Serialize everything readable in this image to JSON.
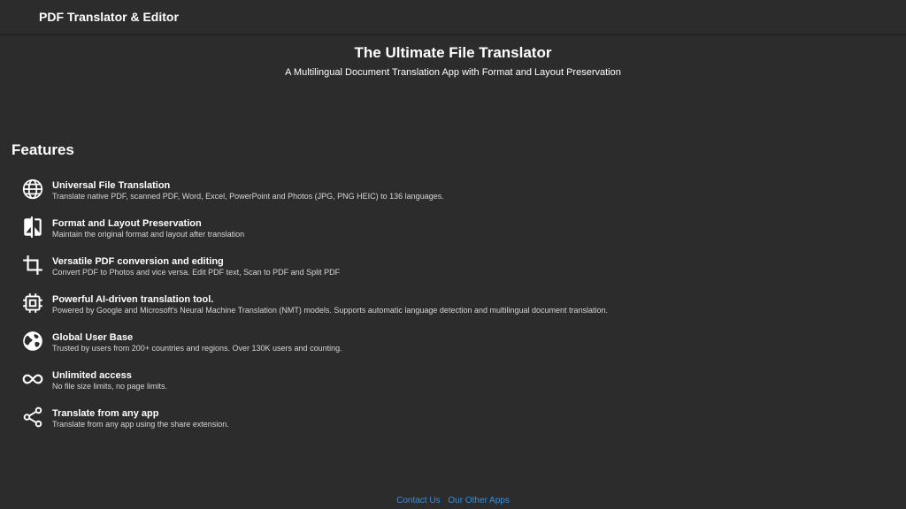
{
  "header": {
    "app_title": "PDF Translator & Editor"
  },
  "hero": {
    "title": "The Ultimate File Translator",
    "subtitle": "A Multilingual Document Translation App with Format and Layout Preservation"
  },
  "features": {
    "heading": "Features",
    "items": [
      {
        "icon": "globe-icon",
        "title": "Universal File Translation",
        "description": "Translate native PDF, scanned PDF, Word, Excel, PowerPoint and Photos (JPG, PNG HEIC) to 136 languages."
      },
      {
        "icon": "compare-icon",
        "title": "Format and Layout Preservation",
        "description": "Maintain the original format and layout after translation"
      },
      {
        "icon": "crop-icon",
        "title": "Versatile PDF conversion and editing",
        "description": "Convert PDF to Photos and vice versa. Edit PDF text, Scan to PDF and Split PDF"
      },
      {
        "icon": "chip-icon",
        "title": "Powerful AI-driven translation tool.",
        "description": "Powered by Google and Microsoft's Neural Machine Translation (NMT) models. Supports automatic language detection and multilingual document translation."
      },
      {
        "icon": "earth-icon",
        "title": "Global User Base",
        "description": "Trusted by users from 200+ countries and regions. Over 130K users and counting."
      },
      {
        "icon": "infinity-icon",
        "title": "Unlimited access",
        "description": "No file size limits, no page limits."
      },
      {
        "icon": "share-icon",
        "title": "Translate from any app",
        "description": "Translate from any app using the share extension."
      }
    ]
  },
  "footer": {
    "contact_label": "Contact Us",
    "other_apps_label": "Our Other Apps"
  },
  "colors": {
    "background": "#2c2c2c",
    "text": "#ffffff",
    "muted_text": "#d6d6d6",
    "link": "#3f8ed8"
  }
}
